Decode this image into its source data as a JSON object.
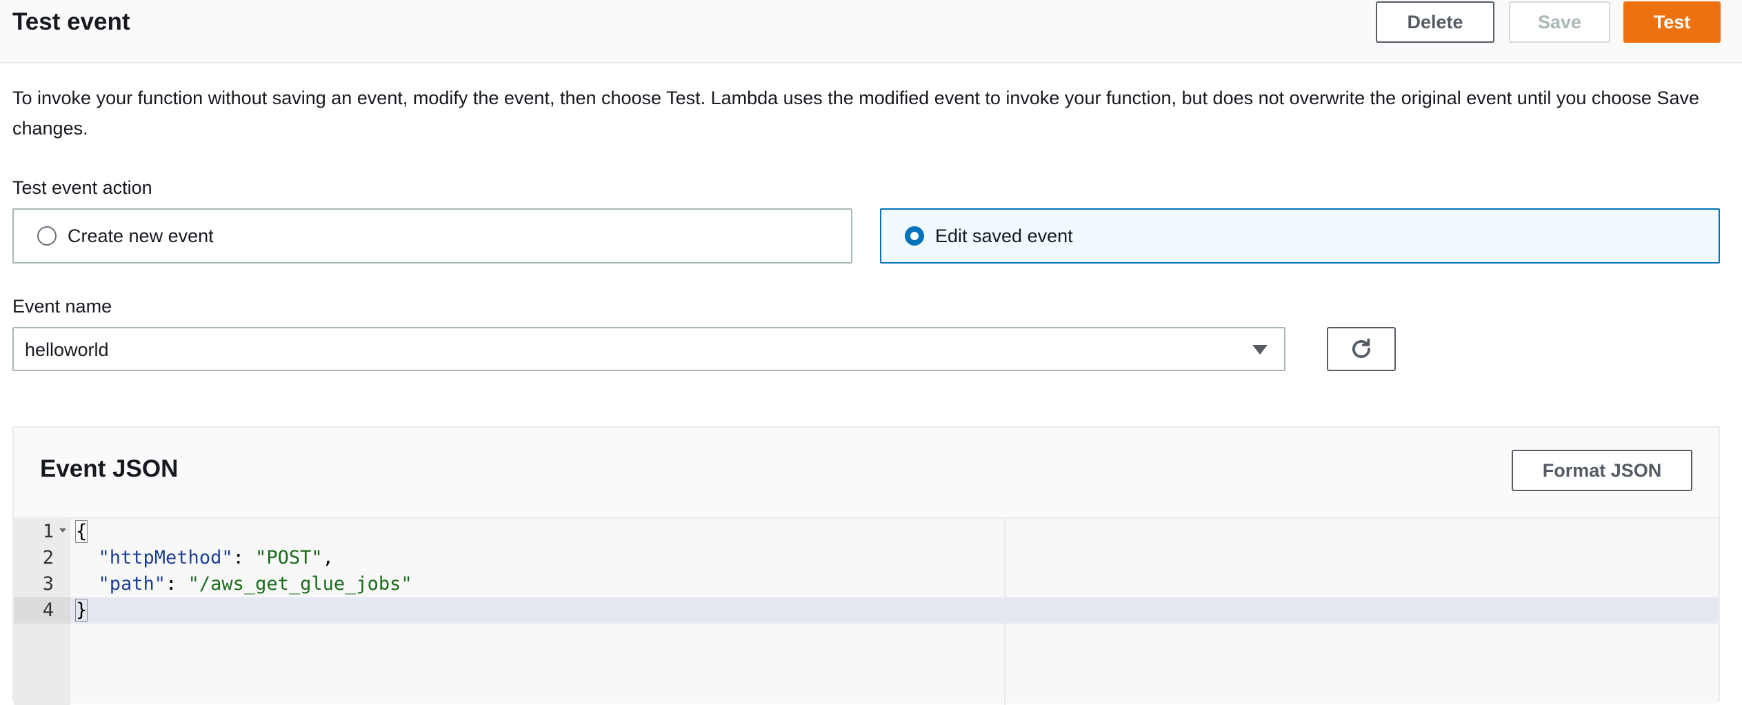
{
  "header": {
    "title": "Test event",
    "delete_label": "Delete",
    "save_label": "Save",
    "test_label": "Test"
  },
  "description": "To invoke your function without saving an event, modify the event, then choose Test. Lambda uses the modified event to invoke your function, but does not overwrite the original event until you choose Save changes.",
  "test_event_action": {
    "label": "Test event action",
    "options": [
      {
        "label": "Create new event",
        "selected": false
      },
      {
        "label": "Edit saved event",
        "selected": true
      }
    ]
  },
  "event_name": {
    "label": "Event name",
    "value": "helloworld"
  },
  "event_json": {
    "title": "Event JSON",
    "format_label": "Format JSON",
    "line_numbers": [
      "1",
      "2",
      "3",
      "4"
    ],
    "lines": [
      {
        "open": "{"
      },
      {
        "key": "\"httpMethod\"",
        "sep": ": ",
        "value": "\"POST\"",
        "end": ","
      },
      {
        "key": "\"path\"",
        "sep": ": ",
        "value": "\"/aws_get_glue_jobs\"",
        "end": ""
      },
      {
        "close": "}"
      }
    ]
  },
  "colors": {
    "primary_button": "#ec7211",
    "radio_selected": "#0073bb",
    "selected_tile_bg": "#f1faff"
  },
  "icons": {
    "refresh": "refresh-icon",
    "dropdown": "caret-down-icon",
    "fold": "fold-arrow-icon"
  }
}
